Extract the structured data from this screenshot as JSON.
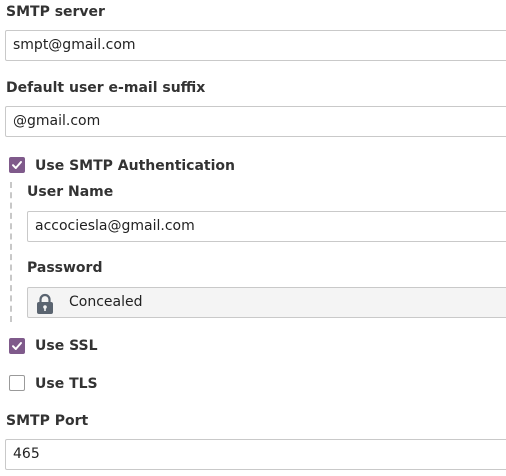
{
  "smtp_server": {
    "label": "SMTP server",
    "value": "smpt@gmail.com"
  },
  "email_suffix": {
    "label": "Default user e-mail suffix",
    "value": "@gmail.com"
  },
  "smtp_auth": {
    "label": "Use SMTP Authentication",
    "checked": true
  },
  "user_name": {
    "label": "User Name",
    "value": "accociesla@gmail.com"
  },
  "password": {
    "label": "Password",
    "value": "Concealed",
    "icon": "lock-icon"
  },
  "use_ssl": {
    "label": "Use SSL",
    "checked": true
  },
  "use_tls": {
    "label": "Use TLS",
    "checked": false
  },
  "smtp_port": {
    "label": "SMTP Port",
    "value": "465"
  },
  "colors": {
    "checkbox_checked": "#7f5a8b",
    "field_border": "#c9c9c9",
    "password_bg": "#f4f4f4"
  }
}
